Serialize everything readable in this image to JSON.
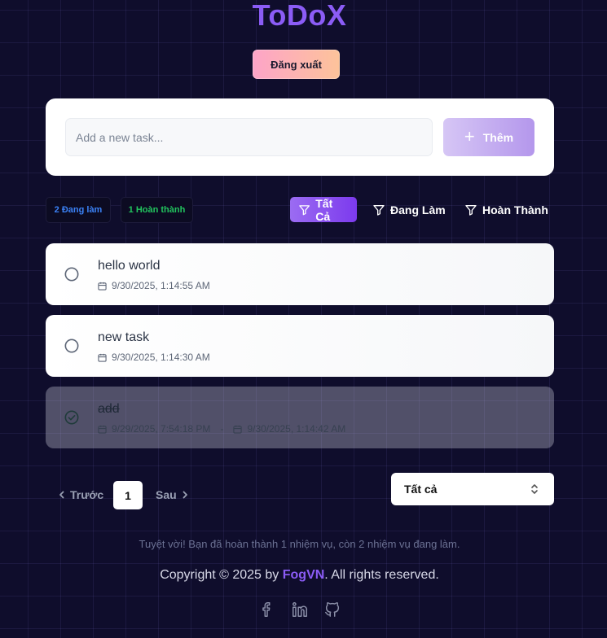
{
  "app": {
    "title": "ToDoX"
  },
  "header": {
    "logout_label": "Đăng xuất"
  },
  "add_task": {
    "placeholder": "Add a new task...",
    "button_label": "Thêm"
  },
  "stats": {
    "active": "2 Đang làm",
    "completed": "1 Hoàn thành"
  },
  "filters": {
    "all": "Tất Cả",
    "active": "Đang Làm",
    "completed": "Hoàn Thành",
    "selected": "all"
  },
  "tasks": [
    {
      "title": "hello world",
      "created": "9/30/2025, 1:14:55 AM",
      "completed": false
    },
    {
      "title": "new task",
      "created": "9/30/2025, 1:14:30 AM",
      "completed": false
    },
    {
      "title": "add",
      "created": "9/29/2025, 7:54:18 PM",
      "completed_at": "9/30/2025, 1:14:42 AM",
      "separator": "-",
      "completed": true
    }
  ],
  "pagination": {
    "prev_label": "Trước",
    "current_page": "1",
    "next_label": "Sau"
  },
  "page_size_select": {
    "value": "Tất cả"
  },
  "footer": {
    "summary": "Tuyệt vời! Bạn đã hoàn thành 1 nhiệm vụ, còn 2 nhiệm vụ đang làm.",
    "copyright_prefix": "Copyright © 2025 by ",
    "brand": "FogVN",
    "copyright_suffix": ". All rights reserved."
  },
  "icons": {
    "plus": "plus-icon",
    "filter": "filter-icon",
    "calendar": "calendar-icon",
    "circle": "circle-icon",
    "check-circle": "check-circle-icon",
    "chevron-left": "chevron-left-icon",
    "chevron-right": "chevron-right-icon",
    "chevrons-up-down": "chevrons-up-down-icon",
    "facebook": "facebook-icon",
    "linkedin": "linkedin-icon",
    "github": "github-icon"
  },
  "colors": {
    "accent": "#8b5cf6",
    "active_badge": "#3b82f6",
    "completed_badge": "#22c55e",
    "background": "#0f0d2c"
  }
}
